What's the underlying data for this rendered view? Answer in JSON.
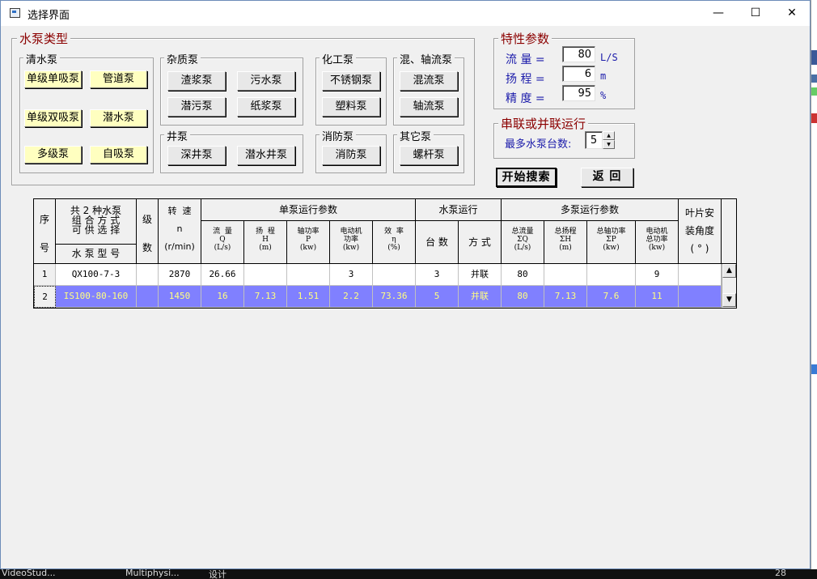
{
  "window": {
    "title": "选择界面",
    "min_glyph": "—",
    "max_glyph": "☐",
    "close_glyph": "✕"
  },
  "pump_type": {
    "legend": "水泵类型",
    "clear_water": {
      "legend": "清水泵",
      "buttons": [
        "单级单吸泵",
        "管道泵",
        "单级双吸泵",
        "潜水泵",
        "多级泵",
        "自吸泵"
      ]
    },
    "sundry": {
      "legend": "杂质泵",
      "buttons": [
        "渣浆泵",
        "污水泵",
        "潜污泵",
        "纸浆泵"
      ]
    },
    "chemical": {
      "legend": "化工泵",
      "buttons": [
        "不锈钢泵",
        "塑料泵"
      ]
    },
    "mixed": {
      "legend": "混、轴流泵",
      "buttons": [
        "混流泵",
        "轴流泵"
      ]
    },
    "well": {
      "legend": "井泵",
      "buttons": [
        "深井泵",
        "潜水井泵"
      ]
    },
    "fire": {
      "legend": "消防泵",
      "buttons": [
        "消防泵"
      ]
    },
    "other": {
      "legend": "其它泵",
      "buttons": [
        "螺杆泵"
      ]
    }
  },
  "params": {
    "legend": "特性参数",
    "flow": {
      "label": "流  量 =",
      "value": "80",
      "unit": "L/S"
    },
    "head": {
      "label": "扬  程 =",
      "value": "6",
      "unit": "m"
    },
    "precision": {
      "label": "精  度 =",
      "value": "95",
      "unit": "%"
    }
  },
  "series": {
    "legend": "串联或并联运行",
    "label": "最多水泵台数:",
    "value": "5",
    "up_glyph": "▲",
    "down_glyph": "▼"
  },
  "actions": {
    "search": "开始搜索",
    "back": "返  回"
  },
  "grid": {
    "headers": {
      "seq_top": "序",
      "seq_bottom": "号",
      "model_top": "共 2 种水泵\n组 合 方 式\n可 供 选 择",
      "model_bottom": "水 泵 型 号",
      "stage_top": "级",
      "stage_bottom": "数",
      "speed": "转  速\nn\n(r/min)",
      "single_group": "单泵运行参数",
      "flow": "流  量\nQ\n(L/s)",
      "head": "扬  程\nH\n(m)",
      "shaft": "轴功率\nP\n(kw)",
      "motor": "电动机\n功率\n(kw)",
      "eff": "效  率\nη\n(%)",
      "run_group": "水泵运行",
      "count": "台  数",
      "mode": "方  式",
      "multi_group": "多泵运行参数",
      "total_flow": "总流量\nΣQ\n(L/s)",
      "total_head": "总扬程\nΣH\n(m)",
      "total_shaft": "总轴功率\nΣP\n(kw)",
      "total_motor": "电动机\n总功率\n(kw)",
      "blade": "叶片安\n装角度\n( ° )"
    },
    "rows": [
      {
        "seq": "1",
        "model": "QX100-7-3",
        "stage": "",
        "speed": "2870",
        "flow": "26.66",
        "head": "",
        "shaft": "",
        "motor": "3",
        "eff": "",
        "count": "3",
        "mode": "并联",
        "total_flow": "80",
        "total_head": "",
        "total_shaft": "",
        "total_motor": "9",
        "blade": ""
      },
      {
        "seq": "2",
        "model": "IS100-80-160",
        "stage": "",
        "speed": "1450",
        "flow": "16",
        "head": "7.13",
        "shaft": "1.51",
        "motor": "2.2",
        "eff": "73.36",
        "count": "5",
        "mode": "并联",
        "total_flow": "80",
        "total_head": "7.13",
        "total_shaft": "7.6",
        "total_motor": "11",
        "blade": ""
      }
    ],
    "scroll_up": "▲",
    "scroll_down": "▼"
  },
  "taskbar": {
    "items": [
      "VideoStud...",
      "Multiphysi...",
      "设计"
    ],
    "tray": "28"
  }
}
